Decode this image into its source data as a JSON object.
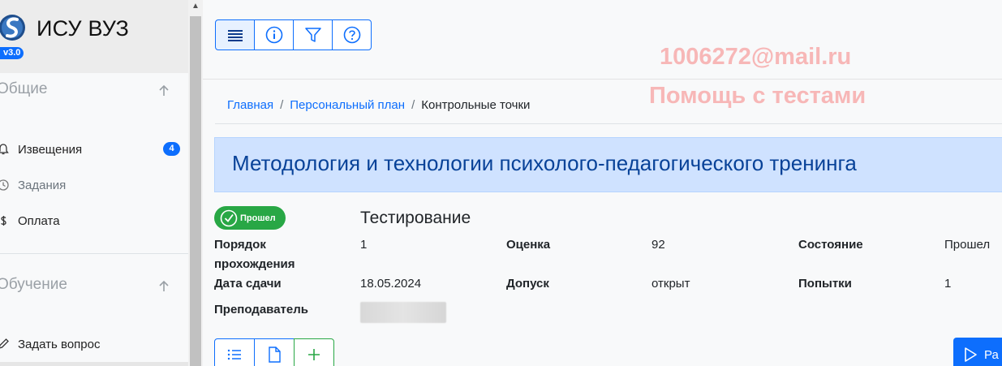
{
  "app": {
    "title": "ИСУ ВУЗ",
    "version": "v3.0"
  },
  "sidebar": {
    "sections": [
      {
        "title": "Общие",
        "items": [
          {
            "label": "Извещения",
            "icon": "bell-icon",
            "badge": "4"
          },
          {
            "label": "Задания",
            "icon": "clock-icon"
          },
          {
            "label": "Оплата",
            "icon": "dollar-icon"
          }
        ]
      },
      {
        "title": "Обучение",
        "items": [
          {
            "label": "Задать вопрос",
            "icon": "pencil-icon"
          }
        ]
      }
    ]
  },
  "toolbar": {
    "buttons": [
      {
        "icon": "list-icon"
      },
      {
        "icon": "info-icon"
      },
      {
        "icon": "filter-icon"
      },
      {
        "icon": "help-icon"
      }
    ]
  },
  "watermark": {
    "email": "1006272@mail.ru",
    "text": "Помощь с тестами"
  },
  "breadcrumb": {
    "home": "Главная",
    "plan": "Персональный план",
    "current": "Контрольные точки",
    "separator": "/"
  },
  "course": {
    "title": "Методология и технологии психолого-педагогического тренинга"
  },
  "checkpoint": {
    "status_badge": "Прошел",
    "title": "Тестирование",
    "fields": {
      "order_label": "Порядок прохождения",
      "order_value": "1",
      "grade_label": "Оценка",
      "grade_value": "92",
      "state_label": "Состояние",
      "state_value": "Прошел",
      "date_label": "Дата сдачи",
      "date_value": "18.05.2024",
      "access_label": "Допуск",
      "access_value": "открыт",
      "attempts_label": "Попытки",
      "attempts_value": "1",
      "teacher_label": "Преподаватель"
    }
  },
  "actions": {
    "start_label": "Ра"
  },
  "colors": {
    "primary": "#0d6efd",
    "success": "#28a745",
    "title_bg": "#cfe2ff",
    "title_text": "#084298",
    "watermark": "#f7b7b7"
  }
}
